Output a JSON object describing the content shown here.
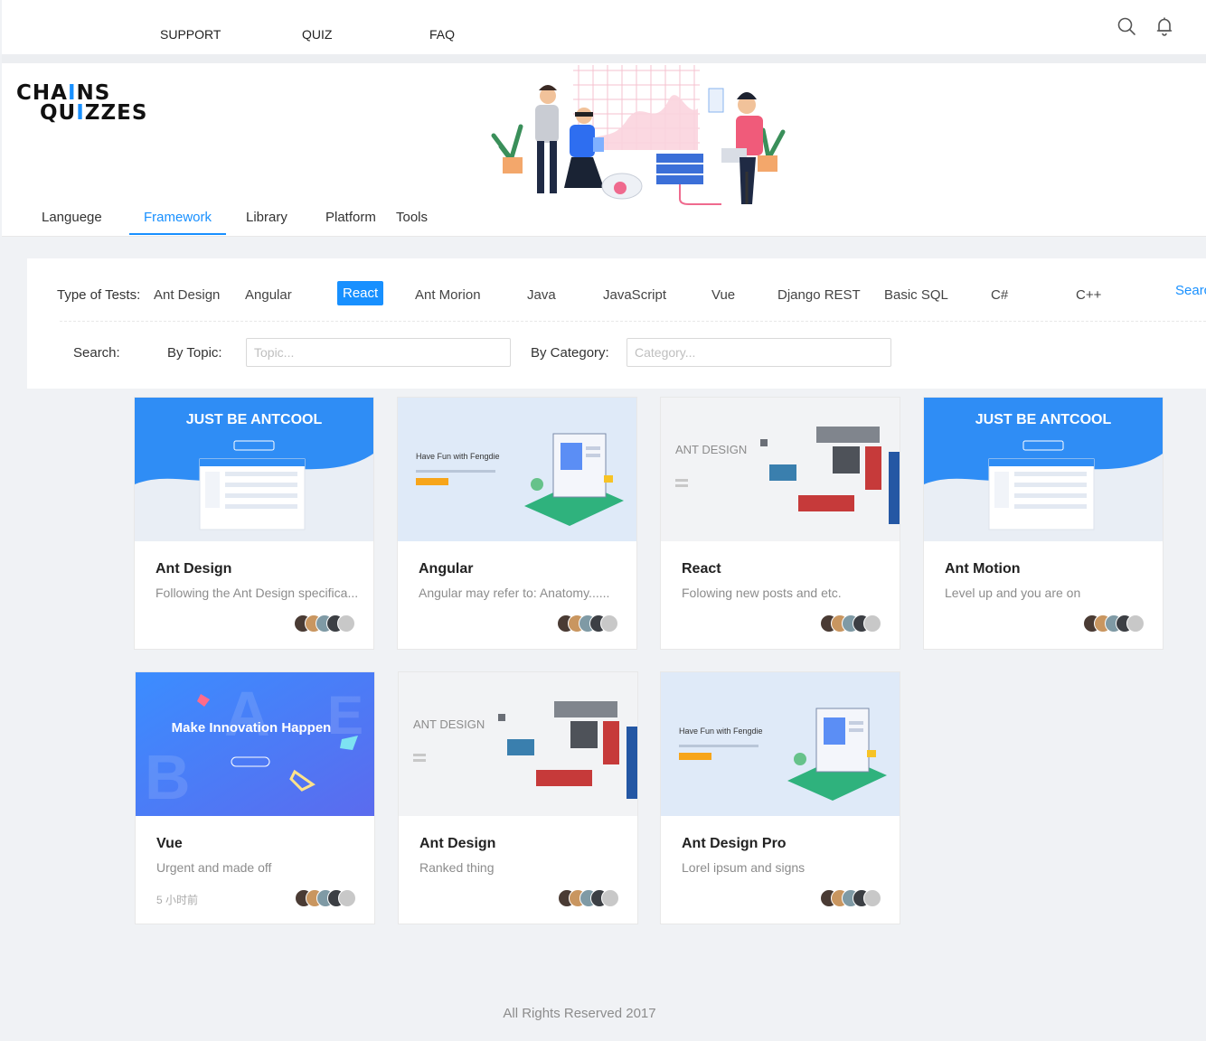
{
  "topnav": {
    "links": [
      "SUPPORT",
      "QUIZ",
      "FAQ"
    ]
  },
  "brand": {
    "line1": "CHAINS",
    "line2": "QUIZZES"
  },
  "tabs": [
    "Languege",
    "Framework",
    "Library",
    "Platform",
    "Tools"
  ],
  "active_tab": "Framework",
  "filter": {
    "type_label": "Type of Tests:",
    "tags": [
      "Ant Design",
      "Angular",
      "React",
      "Ant Morion",
      "Java",
      "JavaScript",
      "Vue",
      "Django REST",
      "Basic SQL",
      "C#",
      "C++"
    ],
    "selected_tag": "React",
    "search_link": "Searc",
    "search_label": "Search:",
    "topic_label": "By Topic:",
    "topic_placeholder": "Topic...",
    "category_label": "By Category:",
    "category_placeholder": "Category..."
  },
  "cards": [
    {
      "title": "Ant Design",
      "desc": "Following the Ant Design specifica...",
      "time": "",
      "cover": "antcool",
      "cover_text": "JUST BE ANTCOOL"
    },
    {
      "title": "Angular",
      "desc": "Angular may refer to: Anatomy......",
      "time": "",
      "cover": "fengdie",
      "cover_text": "Have Fun with Fengdie"
    },
    {
      "title": "React",
      "desc": "Folowing new posts and etc.",
      "time": "",
      "cover": "antdesign",
      "cover_text": "ANT DESIGN"
    },
    {
      "title": "Ant Motion",
      "desc": "Level up and you are on",
      "time": "",
      "cover": "antcool",
      "cover_text": "JUST BE ANTCOOL"
    },
    {
      "title": "Vue",
      "desc": "Urgent and made off",
      "time": "5 小时前",
      "cover": "innovation",
      "cover_text": "Make Innovation Happen"
    },
    {
      "title": "Ant Design",
      "desc": "Ranked thing",
      "time": "",
      "cover": "antdesign",
      "cover_text": "ANT DESIGN"
    },
    {
      "title": "Ant Design Pro",
      "desc": "Lorel ipsum and signs",
      "time": "",
      "cover": "fengdie",
      "cover_text": "Have Fun with Fengdie"
    }
  ],
  "footer": "All Rights Reserved 2017",
  "colors": {
    "accent": "#1890ff",
    "background": "#f0f2f5"
  }
}
